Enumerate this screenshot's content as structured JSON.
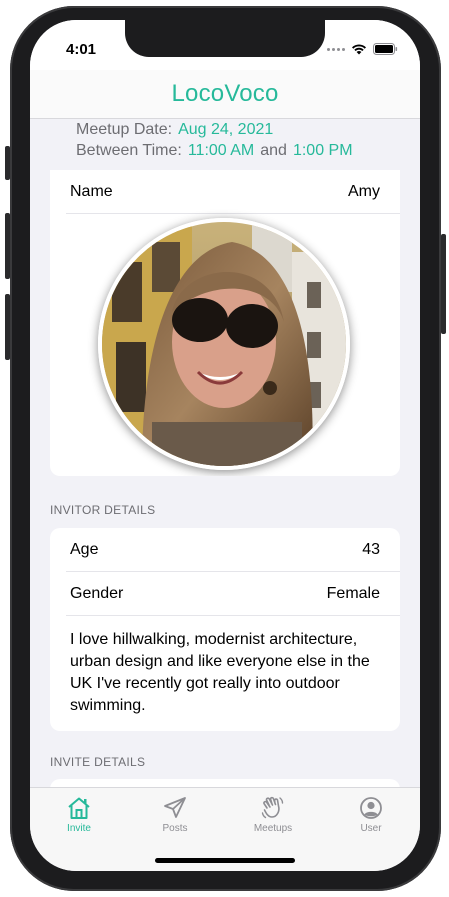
{
  "status_bar": {
    "time": "4:01"
  },
  "app": {
    "title": "LocoVoco",
    "accent": "#26b99a"
  },
  "meetup": {
    "date_label": "Meetup Date:",
    "date_value": "Aug 24, 2021",
    "time_label": "Between Time:",
    "start_time": "11:00 AM",
    "and": "and",
    "end_time": "1:00 PM"
  },
  "profile": {
    "name_label": "Name",
    "name_value": "Amy"
  },
  "invitor_details": {
    "header": "INVITOR DETAILS",
    "age_label": "Age",
    "age_value": "43",
    "gender_label": "Gender",
    "gender_value": "Female",
    "bio": "I love hillwalking, modernist architecture, urban design and like everyone else in the UK I've recently got really into outdoor swimming."
  },
  "invite_details": {
    "header": "INVITE DETAILS"
  },
  "tabs": [
    {
      "label": "Invite",
      "icon": "home-icon",
      "active": true
    },
    {
      "label": "Posts",
      "icon": "paper-plane-icon",
      "active": false
    },
    {
      "label": "Meetups",
      "icon": "waving-hand-icon",
      "active": false
    },
    {
      "label": "User",
      "icon": "user-circle-icon",
      "active": false
    }
  ]
}
